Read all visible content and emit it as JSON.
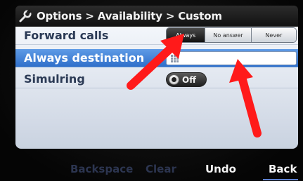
{
  "title_bar": {
    "breadcrumb": "Options > Availability > Custom",
    "icon": "wrench-icon"
  },
  "settings": {
    "forward_calls": {
      "label": "Forward calls",
      "options": [
        "Always",
        "No answer",
        "Never"
      ],
      "selected": "Always"
    },
    "always_destination": {
      "label": "Always destination",
      "value": "",
      "icon": "keypad-grid-icon"
    },
    "simulring": {
      "label": "Simulring",
      "state": "Off"
    }
  },
  "softkeys": {
    "backspace": "Backspace",
    "clear": "Clear",
    "undo": "Undo",
    "back": "Back"
  },
  "colors": {
    "highlight_row": "#2f6fca",
    "panel": "#e6ebf3",
    "annotation_arrow": "#ff1a1a",
    "disabled_softkey": "#2c3550"
  }
}
